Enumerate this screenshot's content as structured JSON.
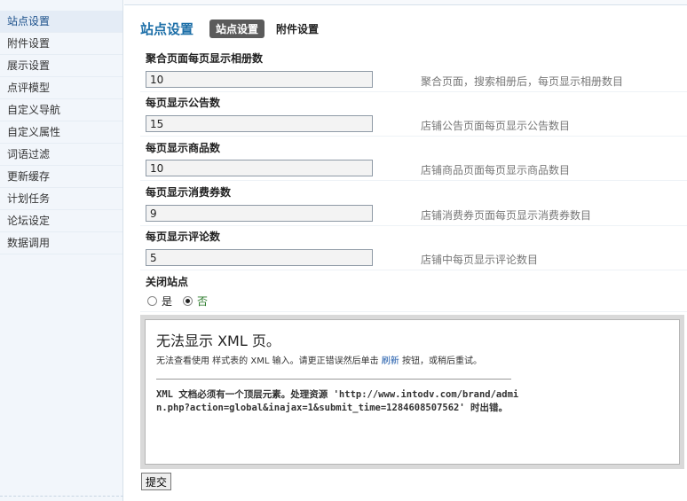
{
  "sidebar": {
    "items": [
      {
        "label": "站点设置"
      },
      {
        "label": "附件设置"
      },
      {
        "label": "展示设置"
      },
      {
        "label": "点评模型"
      },
      {
        "label": "自定义导航"
      },
      {
        "label": "自定义属性"
      },
      {
        "label": "词语过滤"
      },
      {
        "label": "更新缓存"
      },
      {
        "label": "计划任务"
      },
      {
        "label": "论坛设定"
      },
      {
        "label": "数据调用"
      }
    ]
  },
  "header": {
    "title": "站点设置",
    "tabs": [
      {
        "label": "站点设置"
      },
      {
        "label": "附件设置"
      }
    ]
  },
  "fields": [
    {
      "label": "聚合页面每页显示相册数",
      "value": "10",
      "hint": "聚合页面，搜索相册后，每页显示相册数目"
    },
    {
      "label": "每页显示公告数",
      "value": "15",
      "hint": "店铺公告页面每页显示公告数目"
    },
    {
      "label": "每页显示商品数",
      "value": "10",
      "hint": "店铺商品页面每页显示商品数目"
    },
    {
      "label": "每页显示消费券数",
      "value": "9",
      "hint": "店铺消费券页面每页显示消费券数目"
    },
    {
      "label": "每页显示评论数",
      "value": "5",
      "hint": "店铺中每页显示评论数目"
    }
  ],
  "close_site": {
    "label": "关闭站点",
    "options": [
      {
        "label": "是",
        "checked": false
      },
      {
        "label": "否",
        "checked": true
      }
    ]
  },
  "xml_error": {
    "title": "无法显示 XML 页。",
    "desc_before": "无法查看使用 样式表的 XML 输入。请更正错误然后单击 ",
    "refresh_link": "刷新",
    "desc_after": " 按钮，或稍后重试。",
    "detail": "XML 文档必须有一个顶层元素。处理资源 'http://www.intodv.com/brand/admin.php?action=global&inajax=1&submit_time=1284608507562' 时出错。"
  },
  "submit_label": "提交"
}
